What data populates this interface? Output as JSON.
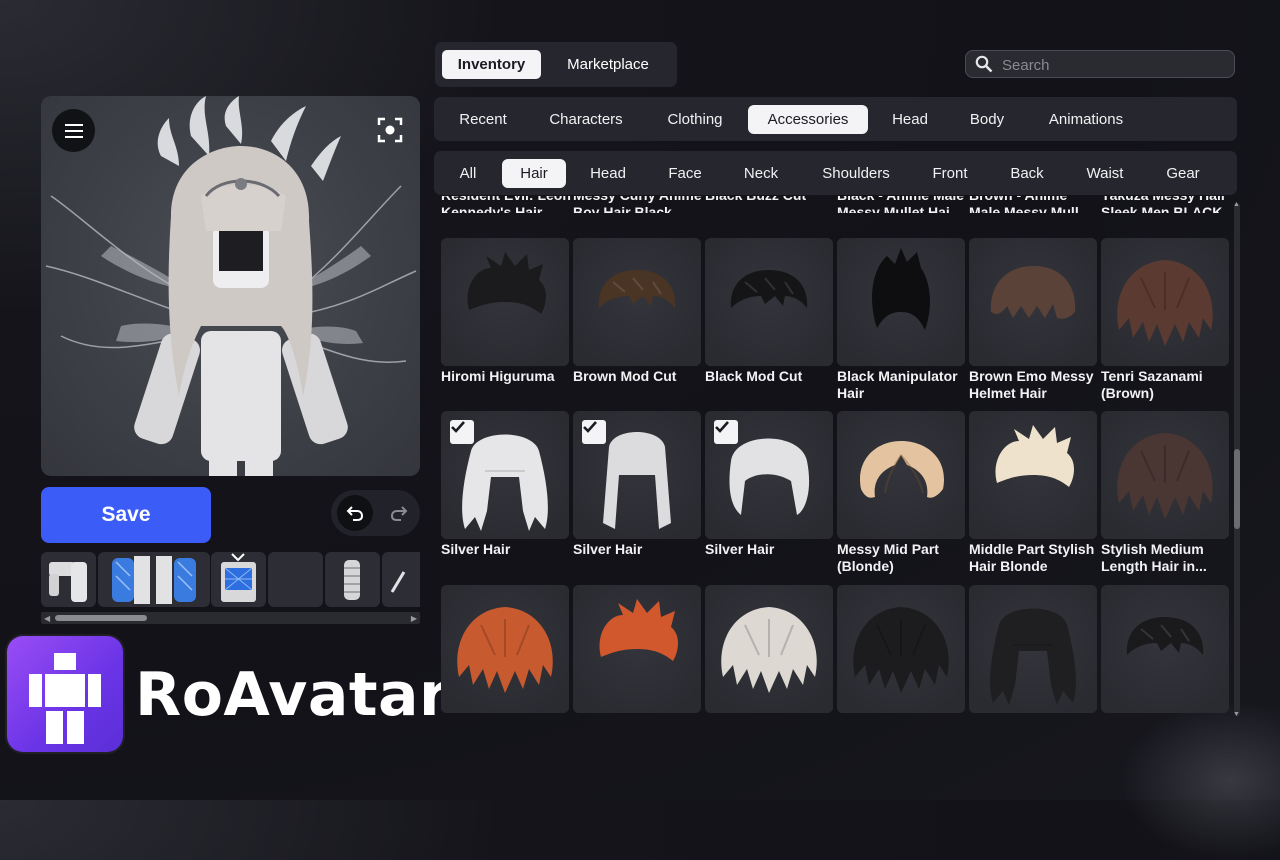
{
  "brand": {
    "name": "RoAvatar"
  },
  "editor": {
    "save_label": "Save"
  },
  "top_tabs": [
    {
      "label": "Inventory",
      "active": true
    },
    {
      "label": "Marketplace",
      "active": false
    }
  ],
  "search": {
    "placeholder": "Search",
    "value": ""
  },
  "categories": [
    {
      "label": "Recent",
      "active": false
    },
    {
      "label": "Characters",
      "active": false
    },
    {
      "label": "Clothing",
      "active": false
    },
    {
      "label": "Accessories",
      "active": true
    },
    {
      "label": "Head",
      "active": false
    },
    {
      "label": "Body",
      "active": false
    },
    {
      "label": "Animations",
      "active": false
    }
  ],
  "subcategories": [
    {
      "label": "All",
      "active": false
    },
    {
      "label": "Hair",
      "active": true
    },
    {
      "label": "Head",
      "active": false
    },
    {
      "label": "Face",
      "active": false
    },
    {
      "label": "Neck",
      "active": false
    },
    {
      "label": "Shoulders",
      "active": false
    },
    {
      "label": "Front",
      "active": false
    },
    {
      "label": "Back",
      "active": false
    },
    {
      "label": "Waist",
      "active": false
    },
    {
      "label": "Gear",
      "active": false
    }
  ],
  "partial_row": [
    {
      "top": "Resident Evil: Leon",
      "bottom": "Kennedy's Hair"
    },
    {
      "top": "Messy Curly Anime",
      "bottom": "Boy Hair Black"
    },
    {
      "top": "Black Buzz Cut",
      "bottom": ""
    },
    {
      "top": "Black - Anime Male",
      "bottom": "Messy Mullet Hai..."
    },
    {
      "top": "Brown - Anime",
      "bottom": "Male Messy Mull..."
    },
    {
      "top": "Yakuza Messy Hair",
      "bottom": "Sleek Men BLACK"
    }
  ],
  "rows": [
    [
      {
        "name": "Hiromi Higuruma",
        "color": "#1b1b1d",
        "style": "spiky",
        "equipped": false
      },
      {
        "name": "Brown Mod Cut",
        "color": "#4a3424",
        "style": "mod",
        "equipped": false
      },
      {
        "name": "Black Mod Cut",
        "color": "#151517",
        "style": "mod",
        "equipped": false
      },
      {
        "name": "Black Manipulator Hair",
        "color": "#0e0e10",
        "style": "tall",
        "equipped": false
      },
      {
        "name": "Brown Emo Messy Helmet Hair",
        "color": "#5a4238",
        "style": "helmet",
        "equipped": false
      },
      {
        "name": "Tenri Sazanami (Brown)",
        "color": "#5b3a32",
        "style": "shaggy",
        "equipped": false
      }
    ],
    [
      {
        "name": "Silver Hair",
        "color": "#e6e6e8",
        "style": "long",
        "equipped": true
      },
      {
        "name": "Silver Hair",
        "color": "#dcdcde",
        "style": "straight",
        "equipped": true
      },
      {
        "name": "Silver Hair",
        "color": "#e2e2e4",
        "style": "bob",
        "equipped": true
      },
      {
        "name": "Messy Mid Part (Blonde)",
        "color": "#e4c4a0",
        "style": "part",
        "equipped": false
      },
      {
        "name": "Middle Part Stylish Hair Blonde",
        "color": "#eee2cc",
        "style": "spiky",
        "equipped": false
      },
      {
        "name": "Stylish Medium Length Hair in...",
        "color": "#4a3632",
        "style": "shaggy",
        "equipped": false
      }
    ],
    [
      {
        "name": "",
        "color": "#c85a30",
        "style": "shaggy",
        "equipped": false
      },
      {
        "name": "",
        "color": "#d0582c",
        "style": "spiky",
        "equipped": false
      },
      {
        "name": "",
        "color": "#ddd8d2",
        "style": "shaggy",
        "equipped": false
      },
      {
        "name": "",
        "color": "#1c1c1e",
        "style": "shaggy",
        "equipped": false
      },
      {
        "name": "",
        "color": "#1f1f21",
        "style": "long",
        "equipped": false
      },
      {
        "name": "",
        "color": "#1a1a1c",
        "style": "mod",
        "equipped": false
      }
    ]
  ],
  "colors": {
    "accent": "#3b5cf6",
    "panel": "#26272e",
    "card": "#2c2d34",
    "logo_gradient_start": "#9a4df5",
    "logo_gradient_end": "#5a2fd6"
  },
  "icons": {
    "menu": "menu-icon",
    "focus": "focus-frame-icon",
    "undo": "undo-icon",
    "redo": "redo-icon",
    "search": "search-icon",
    "check": "check-icon"
  }
}
